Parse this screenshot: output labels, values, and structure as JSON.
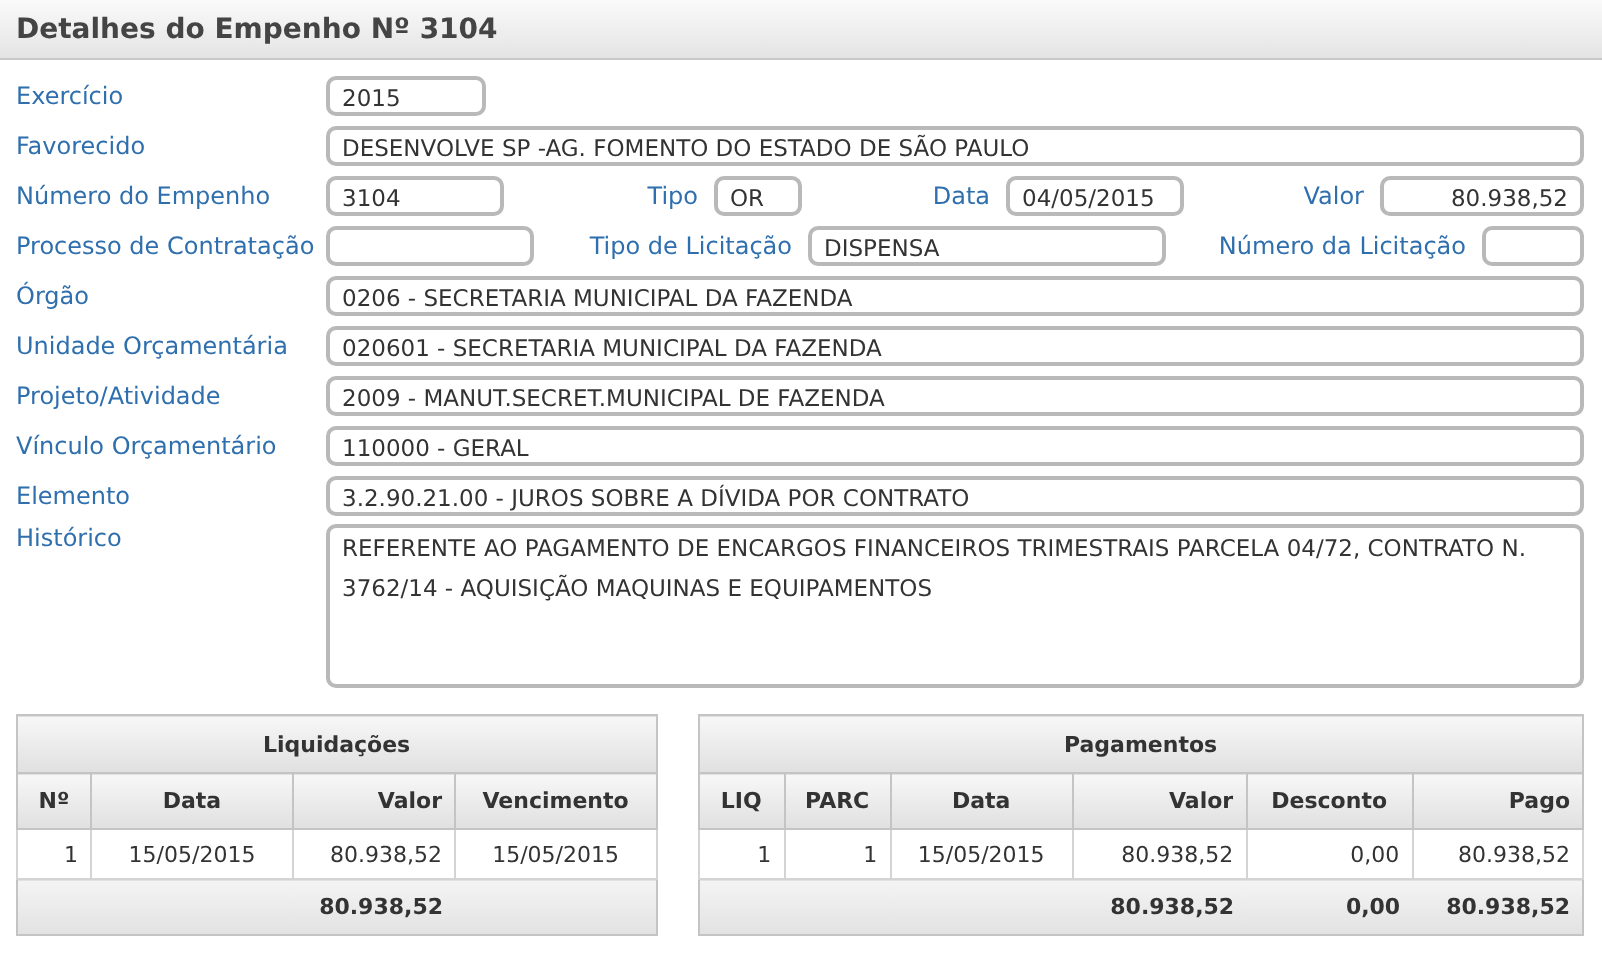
{
  "panel": {
    "title": "Detalhes do Empenho Nº 3104"
  },
  "exercicio": {
    "label": "Exercício",
    "value": "2015"
  },
  "favorecido": {
    "label": "Favorecido",
    "value": "DESENVOLVE SP -AG. FOMENTO DO ESTADO DE SÃO PAULO"
  },
  "empenho_row": [
    {
      "label": "Número do Empenho",
      "value": "3104"
    },
    {
      "label": "Tipo",
      "value": "OR"
    },
    {
      "label": "Data",
      "value": "04/05/2015"
    },
    {
      "label": "Valor",
      "value": "80.938,52"
    }
  ],
  "licitacao_row": [
    {
      "label": "Processo de Contratação"
    },
    {
      "label": "Tipo de Licitação",
      "value": "DISPENSA"
    },
    {
      "label": "Número da Licitação"
    }
  ],
  "full_rows": [
    {
      "label": "Órgão",
      "value": "0206 - SECRETARIA MUNICIPAL DA FAZENDA"
    },
    {
      "label": "Unidade Orçamentária",
      "value": "020601 - SECRETARIA MUNICIPAL DA FAZENDA"
    },
    {
      "label": "Projeto/Atividade",
      "value": "2009 - MANUT.SECRET.MUNICIPAL DE FAZENDA"
    },
    {
      "label": "Vínculo Orçamentário",
      "value": "110000 - GERAL"
    },
    {
      "label": "Elemento",
      "value": "3.2.90.21.00 - JUROS SOBRE A DÍVIDA POR CONTRATO"
    }
  ],
  "historico": {
    "label": "Histórico",
    "value": "REFERENTE AO PAGAMENTO DE ENCARGOS FINANCEIROS TRIMESTRAIS PARCELA 04/72, CONTRATO N. 3762/14 - AQUISIÇÃO MAQUINAS E EQUIPAMENTOS"
  },
  "tables": [
    {
      "title": "Liquidações",
      "columns": [
        {
          "label": "Nº"
        },
        {
          "label": "Data"
        },
        {
          "label": "Valor",
          "total": "80.938,52"
        },
        {
          "label": "Vencimento"
        }
      ],
      "rows": [
        [
          "1",
          "15/05/2015",
          "80.938,52",
          "15/05/2015"
        ]
      ]
    },
    {
      "title": "Pagamentos",
      "columns": [
        {
          "label": "LIQ"
        },
        {
          "label": "PARC"
        },
        {
          "label": "Data"
        },
        {
          "label": "Valor",
          "total": "80.938,52"
        },
        {
          "label": "Desconto",
          "total": "0,00"
        },
        {
          "label": "Pago",
          "total": "80.938,52"
        }
      ],
      "rows": [
        [
          "1",
          "1",
          "15/05/2015",
          "80.938,52",
          "0,00",
          "80.938,52"
        ]
      ]
    }
  ]
}
